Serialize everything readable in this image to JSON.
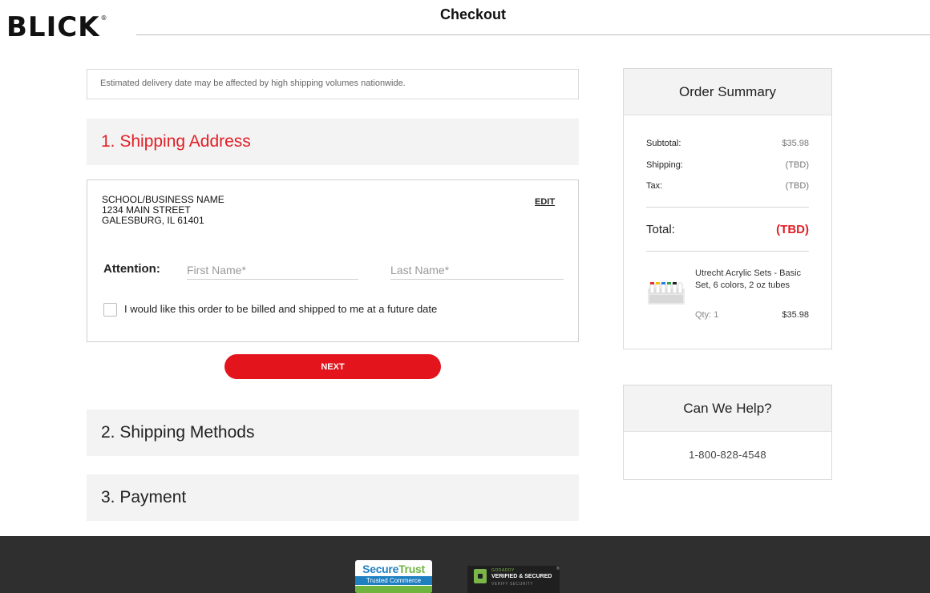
{
  "header": {
    "logo": "BLICK",
    "logo_mark": "®",
    "title": "Checkout"
  },
  "notice": "Estimated delivery date may be affected by high shipping volumes nationwide.",
  "sections": {
    "shipping_address": "1. Shipping Address",
    "shipping_methods": "2. Shipping Methods",
    "payment": "3. Payment"
  },
  "address": {
    "line1": "SCHOOL/BUSINESS NAME",
    "line2": "1234 MAIN STREET",
    "line3": "GALESBURG, IL 61401",
    "edit_label": "EDIT",
    "attention_label": "Attention:",
    "first_name_placeholder": "First Name*",
    "last_name_placeholder": "Last Name*",
    "future_date_label": "I would like this order to be billed and shipped to me at a future date"
  },
  "next_label": "NEXT",
  "summary": {
    "title": "Order Summary",
    "subtotal_label": "Subtotal:",
    "subtotal_value": "$35.98",
    "shipping_label": "Shipping:",
    "shipping_value": "(TBD)",
    "tax_label": "Tax:",
    "tax_value": "(TBD)",
    "total_label": "Total:",
    "total_value": "(TBD)",
    "product_name": "Utrecht Acrylic Sets - Basic Set, 6 colors, 2 oz tubes",
    "qty_label": "Qty: 1",
    "product_price": "$35.98"
  },
  "help": {
    "title": "Can We Help?",
    "phone": "1-800-828-4548"
  },
  "footer": {
    "securetrust_secure": "Secure",
    "securetrust_trust": "Trust",
    "securetrust_sub": "Trusted Commerce",
    "godaddy_small": "GODADDY",
    "godaddy_main": "VERIFIED & SECURED",
    "godaddy_verify": "VERIFY SECURITY",
    "godaddy_mark": "®"
  },
  "colors": {
    "brand_red": "#e3141c",
    "section_bg": "#f3f3f3",
    "footer_bg": "#2f2f2f"
  }
}
